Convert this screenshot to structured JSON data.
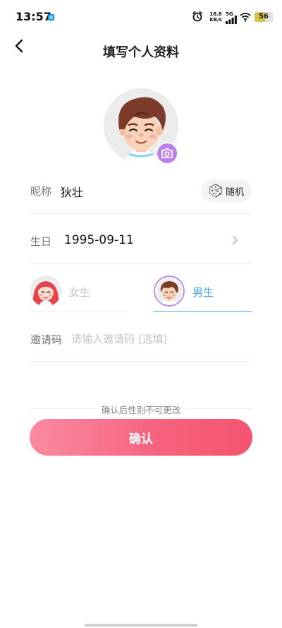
{
  "status_bar": {
    "time": "13:57",
    "net_speed_value": "18.8",
    "net_speed_unit": "KB/s",
    "network_type": "5G",
    "battery_level": "56",
    "battery_fraction": 0.56,
    "icons": [
      "app-notification-icon",
      "alarm-icon",
      "signal-icon",
      "wifi-icon",
      "battery-icon"
    ]
  },
  "nav": {
    "back_icon": "chevron-left-icon",
    "title": "填写个人资料"
  },
  "avatar": {
    "camera_icon": "camera-icon"
  },
  "nickname": {
    "label": "昵称",
    "value": "狄壮",
    "random_button_label": "随机",
    "random_icon": "dice-icon"
  },
  "birthday": {
    "label": "生日",
    "value": "1995-09-11",
    "chevron_icon": "chevron-right-icon"
  },
  "gender": {
    "options": [
      {
        "label": "女生",
        "selected": false
      },
      {
        "label": "男生",
        "selected": true
      }
    ]
  },
  "invite": {
    "label": "邀请码",
    "placeholder": "请输入邀请码 (选填)",
    "value": ""
  },
  "notice": "确认后性别不可更改",
  "confirm_button_label": "确认",
  "colors": {
    "accent_blue": "#4aa6e8",
    "selected_ring": "#b98be6",
    "camera_bg": "#bb80ec",
    "confirm_gradient_start": "#fb8aa2",
    "confirm_gradient_end": "#f45470"
  }
}
